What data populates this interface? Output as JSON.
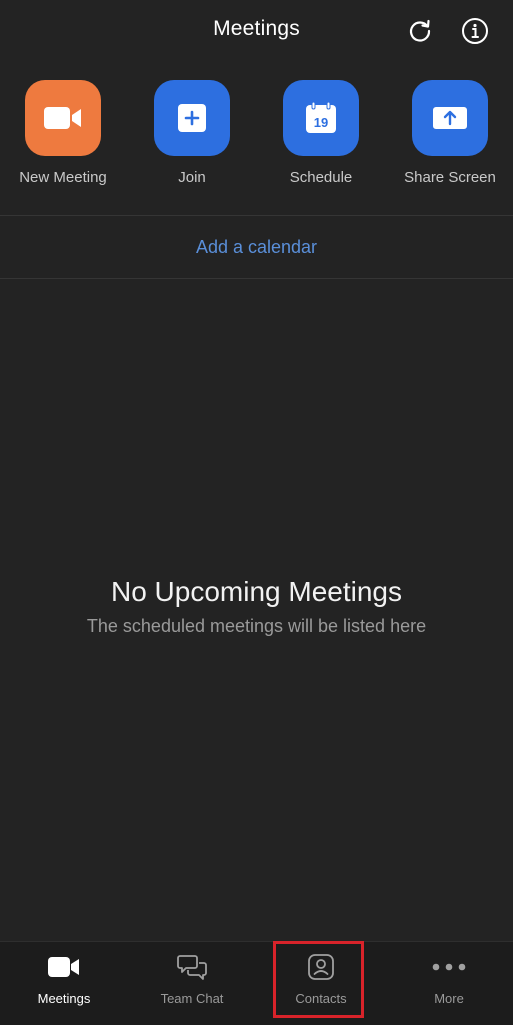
{
  "header": {
    "title": "Meetings",
    "refresh_icon": "refresh-icon",
    "info_icon": "info-icon"
  },
  "actions": [
    {
      "label": "New Meeting",
      "icon": "video-camera-icon",
      "color": "#ee7a3f"
    },
    {
      "label": "Join",
      "icon": "plus-icon",
      "color": "#2d6fe0"
    },
    {
      "label": "Schedule",
      "icon": "calendar-icon",
      "color": "#2d6fe0",
      "calendar_day": "19"
    },
    {
      "label": "Share Screen",
      "icon": "share-screen-icon",
      "color": "#2d6fe0"
    }
  ],
  "calendar": {
    "link_label": "Add a calendar"
  },
  "empty_state": {
    "title": "No Upcoming Meetings",
    "subtitle": "The scheduled meetings will be listed here"
  },
  "tabbar": {
    "tabs": [
      {
        "label": "Meetings",
        "icon": "video-camera-icon",
        "active": true
      },
      {
        "label": "Team Chat",
        "icon": "chat-bubbles-icon",
        "active": false
      },
      {
        "label": "Contacts",
        "icon": "contact-icon",
        "active": false,
        "highlighted": true
      },
      {
        "label": "More",
        "icon": "ellipsis-icon",
        "active": false
      }
    ]
  },
  "colors": {
    "background": "#232323",
    "accent_blue": "#2d6fe0",
    "accent_orange": "#ee7a3f",
    "link_blue": "#5a8fd9",
    "highlight_red": "#d8232a"
  }
}
